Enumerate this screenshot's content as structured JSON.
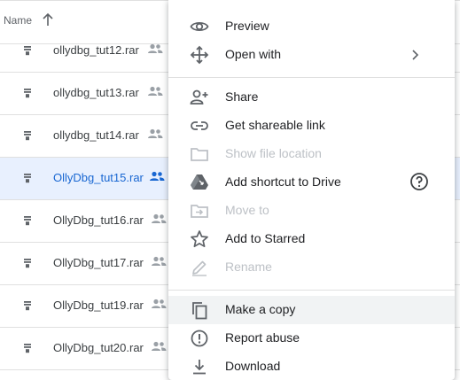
{
  "list": {
    "header": {
      "name_label": "Name",
      "sort_icon": "arrow-up-icon"
    },
    "rows": [
      {
        "name": "ollydbg_tut12.rar",
        "selected": false
      },
      {
        "name": "ollydbg_tut13.rar",
        "selected": false
      },
      {
        "name": "ollydbg_tut14.rar",
        "selected": false
      },
      {
        "name": "OllyDbg_tut15.rar",
        "selected": true
      },
      {
        "name": "OllyDbg_tut16.rar",
        "selected": false
      },
      {
        "name": "OllyDbg_tut17.rar",
        "selected": false
      },
      {
        "name": "OllyDbg_tut19.rar",
        "selected": false
      },
      {
        "name": "OllyDbg_tut20.rar",
        "selected": false
      }
    ]
  },
  "menu": {
    "items": [
      {
        "label": "Preview",
        "icon": "eye-icon",
        "disabled": false
      },
      {
        "label": "Open with",
        "icon": "move-arrows-icon",
        "disabled": false,
        "submenu": true
      },
      {
        "label": "Share",
        "icon": "add-person-icon",
        "disabled": false
      },
      {
        "label": "Get shareable link",
        "icon": "link-icon",
        "disabled": false
      },
      {
        "label": "Show file location",
        "icon": "folder-icon",
        "disabled": true
      },
      {
        "label": "Add shortcut to Drive",
        "icon": "drive-shortcut-icon",
        "disabled": false,
        "help": true
      },
      {
        "label": "Move to",
        "icon": "move-to-folder-icon",
        "disabled": true
      },
      {
        "label": "Add to Starred",
        "icon": "star-icon",
        "disabled": false
      },
      {
        "label": "Rename",
        "icon": "pencil-icon",
        "disabled": true
      },
      {
        "label": "Make a copy",
        "icon": "copy-icon",
        "disabled": false,
        "hover": true
      },
      {
        "label": "Report abuse",
        "icon": "alert-circle-icon",
        "disabled": false
      },
      {
        "label": "Download",
        "icon": "download-icon",
        "disabled": false
      }
    ]
  },
  "colors": {
    "selected_row_bg": "#e8f0fe",
    "selected_text": "#1967d2",
    "disabled_text": "#bdc1c6",
    "icon_gray": "#5f6368",
    "hover_bg": "#f1f3f4"
  }
}
